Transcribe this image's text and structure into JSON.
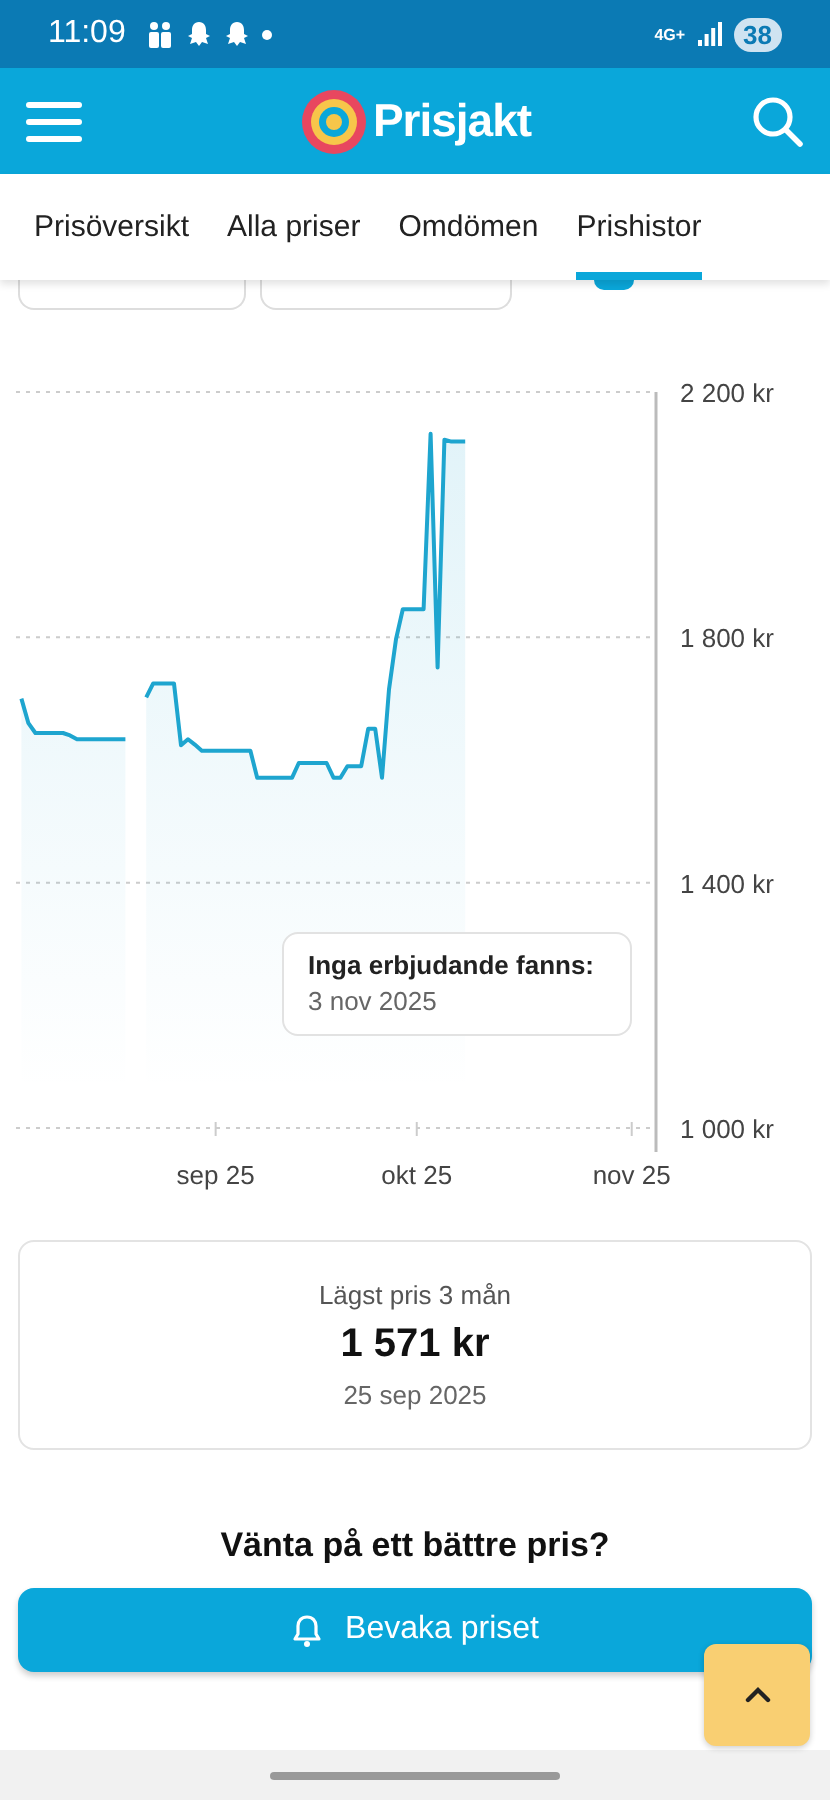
{
  "status_bar": {
    "time": "11:09",
    "network": "4G+",
    "battery": "38"
  },
  "header": {
    "logo_text": "Prisjakt"
  },
  "tabs": [
    {
      "label": "Prisöversikt",
      "selected": false
    },
    {
      "label": "Alla priser",
      "selected": false
    },
    {
      "label": "Omdömen",
      "selected": false
    },
    {
      "label": "Prishistor",
      "selected": true
    }
  ],
  "chart": {
    "chart_data": {
      "type": "area",
      "categories": [
        null,
        null,
        null,
        null,
        null,
        null,
        null,
        null,
        null,
        null,
        null,
        null,
        null,
        null,
        null,
        null,
        null,
        null,
        null,
        null,
        null,
        null,
        null,
        null,
        null,
        null,
        null,
        null,
        "sep 25",
        null,
        null,
        null,
        null,
        null,
        null,
        null,
        null,
        null,
        null,
        null,
        null,
        null,
        null,
        null,
        null,
        null,
        null,
        null,
        null,
        null,
        null,
        null,
        null,
        null,
        null,
        null,
        null,
        "okt 25",
        null,
        null,
        null,
        null,
        null,
        null,
        null,
        null,
        null,
        null,
        null,
        null,
        null,
        null,
        null,
        null,
        null,
        null,
        null,
        null,
        null,
        null,
        null,
        null,
        null,
        null,
        null,
        null,
        null,
        null,
        "nov 25",
        null,
        null,
        null
      ],
      "series": [
        {
          "color": "#1ea5cf",
          "values": [
            1700,
            1660,
            1644,
            1644,
            1644,
            1644,
            1644,
            1640,
            1634,
            1634,
            1634,
            1634,
            1634,
            1634,
            1634,
            1634,
            null,
            null,
            1702,
            1725,
            1725,
            1725,
            1725,
            1624,
            1634,
            1625,
            1615,
            1615,
            1615,
            1615,
            1615,
            1615,
            1615,
            1615,
            1571,
            1571,
            1571,
            1571,
            1571,
            1571,
            1595,
            1595,
            1595,
            1595,
            1595,
            1571,
            1571,
            1590,
            1590,
            1590,
            1651,
            1651,
            1571,
            1715,
            1797,
            1846,
            1846,
            1846,
            1846,
            2132,
            1751,
            2122,
            2119,
            2119,
            2119,
            null,
            null,
            null,
            null,
            null,
            null,
            null,
            null,
            null,
            null,
            null,
            null,
            null,
            null,
            null,
            null,
            null,
            null,
            null,
            null,
            null,
            null,
            null,
            null,
            null,
            null,
            null
          ]
        }
      ],
      "ylim": [
        1000,
        2200
      ],
      "yticks": [
        {
          "value": 2200,
          "label": "2 200 kr"
        },
        {
          "value": 1800,
          "label": "1 800 kr"
        },
        {
          "value": 1400,
          "label": "1 400 kr"
        },
        {
          "value": 1000,
          "label": "1 000 kr"
        }
      ]
    },
    "tooltip": {
      "title": "Inga erbjudande fanns:",
      "date": "3 nov 2025"
    }
  },
  "lowest_price": {
    "label": "Lägst pris 3 mån",
    "price": "1 571 kr",
    "date": "25 sep 2025"
  },
  "price_watch": {
    "heading": "Vänta på ett bättre pris?",
    "button": "Bevaka priset"
  }
}
